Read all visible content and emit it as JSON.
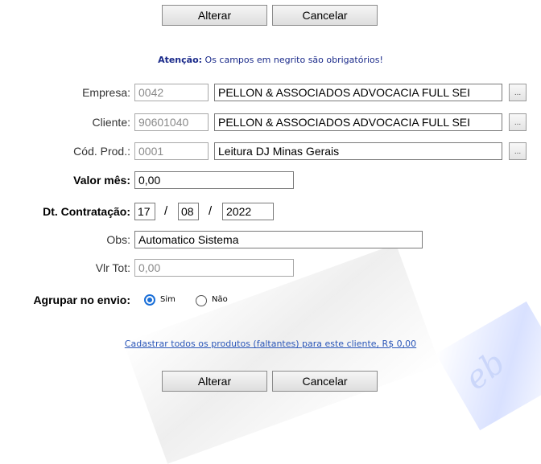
{
  "actions": {
    "alterar_label": "Alterar",
    "cancelar_label": "Cancelar"
  },
  "notice": {
    "prefix": "Atenção:",
    "text": " Os campos em negrito são obrigatórios!"
  },
  "form": {
    "empresa": {
      "label": "Empresa:",
      "code": "0042",
      "name": "PELLON & ASSOCIADOS ADVOCACIA FULL SEI",
      "lookup": "..."
    },
    "cliente": {
      "label": "Cliente:",
      "code": "90601040",
      "name": "PELLON & ASSOCIADOS ADVOCACIA FULL SEI",
      "lookup": "..."
    },
    "cod_prod": {
      "label": "Cód. Prod.:",
      "code": "0001",
      "name": "Leitura DJ Minas Gerais",
      "lookup": "..."
    },
    "valor_mes": {
      "label": "Valor mês:",
      "value": "0,00"
    },
    "dt_contratacao": {
      "label": "Dt. Contratação:",
      "day": "17",
      "month": "08",
      "year": "2022",
      "separator": "/"
    },
    "obs": {
      "label": "Obs:",
      "value": "Automatico Sistema"
    },
    "vlr_tot": {
      "label": "Vlr Tot:",
      "value": "0,00"
    },
    "agrupar": {
      "label": "Agrupar no envio:",
      "options": [
        "Sim",
        "Não"
      ],
      "selected": "Sim"
    }
  },
  "link": {
    "text": "Cadastrar todos os produtos (faltantes) para este cliente, R$ 0,00"
  },
  "colors": {
    "radio_accent": "#1a6fd8",
    "link": "#2a56b8",
    "notice": "#1a2a8a"
  }
}
